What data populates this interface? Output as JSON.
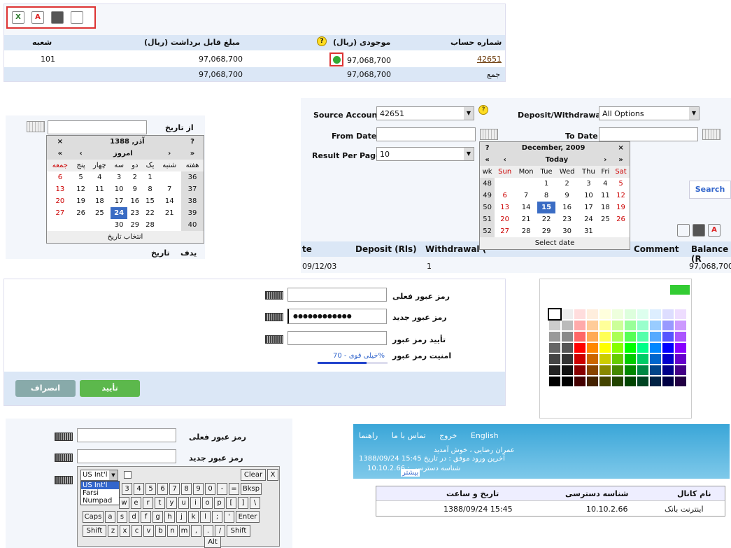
{
  "panel1": {
    "headers": [
      "شعبه",
      "مبلغ قابل برداشت (ریال)",
      "موجودی (ریال)",
      "شماره حساب"
    ],
    "row": {
      "branch": "101",
      "withdrawable": "97,068,700",
      "balance": "97,068,700",
      "account": "42651"
    },
    "total": {
      "withdrawable": "97,068,700",
      "balance": "97,068,700",
      "label": "جمع"
    }
  },
  "panel2": {
    "from_label": "از تاریخ",
    "month": "آذر, 1388",
    "today": "امروز",
    "help": "?",
    "close": "×",
    "weekdays": [
      "جمعه",
      "پنج",
      "چهار",
      "سه",
      "دو",
      "یک",
      "شنبه",
      "هفته"
    ],
    "rows": [
      [
        "6",
        "5",
        "4",
        "3",
        "2",
        "1",
        "",
        "36"
      ],
      [
        "13",
        "12",
        "11",
        "10",
        "9",
        "8",
        "7",
        "37"
      ],
      [
        "20",
        "19",
        "18",
        "17",
        "16",
        "15",
        "14",
        "38"
      ],
      [
        "27",
        "26",
        "25",
        "24",
        "23",
        "22",
        "21",
        "39"
      ],
      [
        "",
        "",
        "",
        "30",
        "29",
        "28",
        "",
        "40"
      ]
    ],
    "footer": "انتخاب تاریخ",
    "nav": [
      "«",
      "‹",
      "›",
      "»"
    ],
    "stray": [
      "یدف",
      "تاریخ"
    ]
  },
  "panel3": {
    "source_label": "Source Account",
    "source_value": "42651",
    "dw_label": "Deposit/Withdrawal",
    "dw_value": "All Options",
    "from_label": "From Date",
    "to_label": "To Date",
    "rpp_label": "Result Per Page",
    "rpp_value": "10",
    "search": "Search",
    "cal": {
      "month": "December, 2009",
      "today": "Today",
      "help": "?",
      "close": "×",
      "weekdays": [
        "wk",
        "Sun",
        "Mon",
        "Tue",
        "Wed",
        "Thu",
        "Fri",
        "Sat"
      ],
      "rows": [
        [
          "48",
          "",
          "",
          "1",
          "2",
          "3",
          "4",
          "5"
        ],
        [
          "49",
          "6",
          "7",
          "8",
          "9",
          "10",
          "11",
          "12"
        ],
        [
          "50",
          "13",
          "14",
          "15",
          "16",
          "17",
          "18",
          "19"
        ],
        [
          "51",
          "20",
          "21",
          "22",
          "23",
          "24",
          "25",
          "26"
        ],
        [
          "52",
          "27",
          "28",
          "29",
          "30",
          "31",
          "",
          ""
        ]
      ],
      "footer": "Select date"
    },
    "table_headers": [
      "te",
      "Deposit (Rls)",
      "Withdrawal (",
      "Comment",
      "Balance (R"
    ],
    "table_row": [
      "09/12/03",
      "1",
      "97,068,700"
    ]
  },
  "panel4": {
    "current_label": "رمز عبور فعلی",
    "new_label": "رمز عبور جدید",
    "confirm_label": "تأیید رمز عبور",
    "new_value": "●●●●●●●●●●●●",
    "strength_label": "امنیت رمز عبور",
    "strength_text": "خیلی قوی - 70%",
    "strength": 0.7,
    "ok": "تأیید",
    "cancel": "انصراف"
  },
  "panel5": {
    "colors": [
      [
        "#ffffff",
        "#eeeeee",
        "#ffdddd",
        "#ffeedd",
        "#ffffdd",
        "#eeffdd",
        "#ddffdd",
        "#ddffee",
        "#ddeeff",
        "#ddddff",
        "#eeddff"
      ],
      [
        "#cccccc",
        "#bbbbbb",
        "#ffaaaa",
        "#ffcc99",
        "#ffff99",
        "#ccff99",
        "#99ff99",
        "#99ffcc",
        "#99ccff",
        "#9999ff",
        "#cc99ff"
      ],
      [
        "#999999",
        "#888888",
        "#ff6666",
        "#ffaa55",
        "#ffff55",
        "#aaff55",
        "#55ff55",
        "#55ffaa",
        "#55aaff",
        "#5555ff",
        "#aa55ff"
      ],
      [
        "#666666",
        "#555555",
        "#ff0000",
        "#ff8800",
        "#ffff00",
        "#88ff00",
        "#00ff00",
        "#00ff88",
        "#0088ff",
        "#0000ff",
        "#8800ff"
      ],
      [
        "#444444",
        "#333333",
        "#cc0000",
        "#cc6600",
        "#cccc00",
        "#66cc00",
        "#00cc00",
        "#00cc66",
        "#0066cc",
        "#0000cc",
        "#6600cc"
      ],
      [
        "#222222",
        "#111111",
        "#880000",
        "#884400",
        "#888800",
        "#448800",
        "#008800",
        "#008844",
        "#004488",
        "#000088",
        "#440088"
      ],
      [
        "#000000",
        "#000000",
        "#440000",
        "#442200",
        "#444400",
        "#224400",
        "#004400",
        "#004422",
        "#002244",
        "#000044",
        "#220044"
      ]
    ]
  },
  "panel6": {
    "current_label": "رمز عبور فعلی",
    "new_label": "رمز عبور جدید",
    "layout": "US Int'l",
    "options": [
      "US Int'l",
      "Farsi",
      "Numpad"
    ],
    "clear": "Clear",
    "close": "X",
    "row1": [
      "3",
      "4",
      "5",
      "6",
      "7",
      "8",
      "9",
      "0",
      "-",
      "=",
      "Bksp"
    ],
    "row2": [
      "w",
      "e",
      "r",
      "t",
      "y",
      "u",
      "i",
      "o",
      "p",
      "[",
      "]",
      "\\"
    ],
    "row3": [
      "Caps",
      "a",
      "s",
      "d",
      "f",
      "g",
      "h",
      "j",
      "k",
      "l",
      ";",
      "'",
      "Enter"
    ],
    "row4": [
      "Shift",
      "z",
      "x",
      "c",
      "v",
      "b",
      "n",
      "m",
      ",",
      ".",
      "/",
      "Shift"
    ],
    "alt": "Alt"
  },
  "panel7": {
    "nav": [
      "English",
      "راهنما",
      "تماس با ما",
      "خروج"
    ],
    "welcome": "عمران رضایی ، خوش آمدید",
    "last_login": "آخرین ورود موفق : در تاریخ 15:45 1388/09/24",
    "access_id": "شناسه دسترسی : 10.10.2.66",
    "more": "بیشتر",
    "headers": [
      "نام کانال",
      "شناسه دسترسی",
      "تاریخ و ساعت"
    ],
    "row": [
      "اینترنت بانک",
      "10.10.2.66",
      "1388/09/24 15:45"
    ]
  }
}
